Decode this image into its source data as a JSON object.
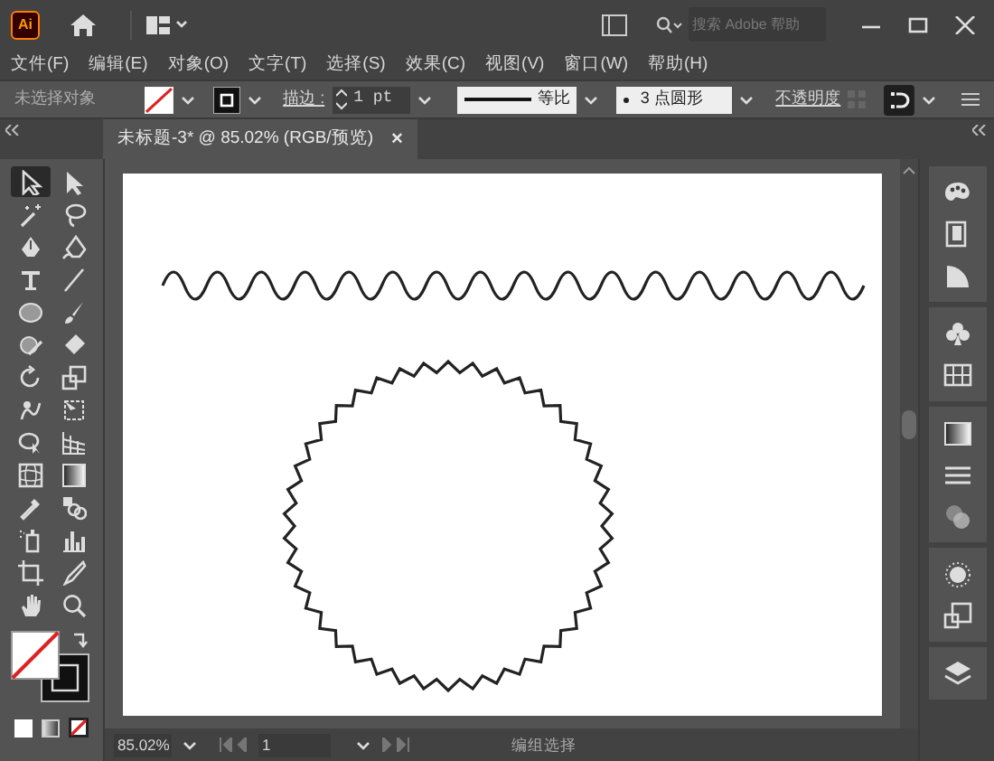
{
  "app_logo": "Ai",
  "search": {
    "placeholder": "搜索 Adobe 帮助"
  },
  "menu": [
    "文件(F)",
    "编辑(E)",
    "对象(O)",
    "文字(T)",
    "选择(S)",
    "效果(C)",
    "视图(V)",
    "窗口(W)",
    "帮助(H)"
  ],
  "control_bar": {
    "selection": "未选择对象",
    "stroke_label": "描边 :",
    "stroke_weight": "1 pt",
    "profile": "等比",
    "brush": "3 点圆形",
    "opacity_label": "不透明度"
  },
  "document_tab": {
    "title": "未标题-3* @ 85.02% (RGB/预览)",
    "close": "×",
    "selected": true
  },
  "tools": [
    {
      "selected": true
    },
    {
      "selected": false
    },
    {
      "selected": false
    },
    {
      "selected": false
    },
    {
      "selected": false
    },
    {
      "selected": false
    },
    {
      "selected": false
    },
    {
      "selected": false
    },
    {
      "selected": false
    },
    {
      "selected": false
    },
    {
      "selected": false
    },
    {
      "selected": false
    },
    {
      "selected": false
    },
    {
      "selected": false
    },
    {
      "selected": false
    },
    {
      "selected": false
    },
    {
      "selected": false
    },
    {
      "selected": false
    },
    {
      "selected": false
    },
    {
      "selected": false
    },
    {
      "selected": false
    },
    {
      "selected": false
    },
    {
      "selected": false
    },
    {
      "selected": false
    },
    {
      "selected": false
    },
    {
      "selected": false
    },
    {
      "selected": false
    },
    {
      "selected": false
    }
  ],
  "status_bar": {
    "zoom": "85.02%",
    "artboard": "1",
    "tool": "编组选择"
  }
}
